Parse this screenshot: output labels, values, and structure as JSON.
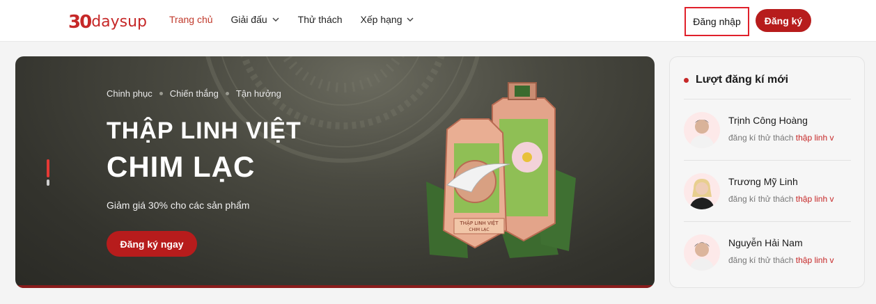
{
  "header": {
    "logo_num": "30",
    "logo_text": "daysup",
    "nav": [
      {
        "label": "Trang chủ",
        "active": true
      },
      {
        "label": "Giải đấu",
        "dropdown": true
      },
      {
        "label": "Thử thách"
      },
      {
        "label": "Xếp hạng",
        "dropdown": true
      }
    ],
    "login_label": "Đăng nhập",
    "signup_label": "Đăng ký"
  },
  "banner": {
    "crumbs": [
      "Chinh phục",
      "Chiến thắng",
      "Tận hưởng"
    ],
    "title_line1": "THẬP LINH VIỆT",
    "title_line2": "CHIM LẠC",
    "description": "Giảm giá 30% cho các sản phẩm",
    "cta_label": "Đăng ký ngay",
    "medal_text1": "THẬP LINH VIỆT",
    "medal_text2": "CHIM LẠC"
  },
  "sidebar": {
    "title": "Lượt đăng kí mới",
    "entries": [
      {
        "name": "Trịnh Công Hoàng",
        "action": "đăng kí thử thách",
        "target": "thập linh v"
      },
      {
        "name": "Trương Mỹ Linh",
        "action": "đăng kí thử thách",
        "target": "thập linh v"
      },
      {
        "name": "Nguyễn Hải Nam",
        "action": "đăng kí thử thách",
        "target": "thập linh v"
      }
    ]
  },
  "colors": {
    "brand": "#c62828",
    "button": "#b71c1c",
    "highlight_border": "#e0202a"
  }
}
